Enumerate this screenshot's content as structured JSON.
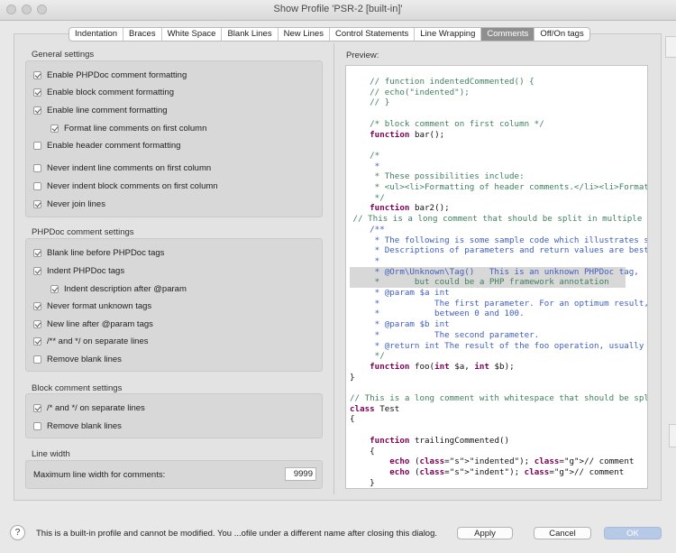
{
  "window": {
    "title": "Show Profile 'PSR-2 [built-in]'"
  },
  "tabs": [
    {
      "label": "Indentation",
      "active": false
    },
    {
      "label": "Braces",
      "active": false
    },
    {
      "label": "White Space",
      "active": false
    },
    {
      "label": "Blank Lines",
      "active": false
    },
    {
      "label": "New Lines",
      "active": false
    },
    {
      "label": "Control Statements",
      "active": false
    },
    {
      "label": "Line Wrapping",
      "active": false
    },
    {
      "label": "Comments",
      "active": true
    },
    {
      "label": "Off/On tags",
      "active": false
    }
  ],
  "general": {
    "title": "General settings",
    "options": [
      {
        "label": "Enable PHPDoc comment formatting",
        "checked": true
      },
      {
        "label": "Enable block comment formatting",
        "checked": true
      },
      {
        "label": "Enable line comment formatting",
        "checked": true
      },
      {
        "label": "Format line comments on first column",
        "checked": true
      },
      {
        "label": "Enable header comment formatting",
        "checked": false
      },
      {
        "label": "Never indent line comments on first column",
        "checked": false
      },
      {
        "label": "Never indent block comments on first column",
        "checked": false
      },
      {
        "label": "Never join lines",
        "checked": true
      }
    ]
  },
  "phpdoc": {
    "title": "PHPDoc comment settings",
    "options": [
      {
        "label": "Blank line before PHPDoc tags",
        "checked": true
      },
      {
        "label": "Indent PHPDoc tags",
        "checked": true
      },
      {
        "label": "Indent description after @param",
        "checked": true
      },
      {
        "label": "Never format unknown tags",
        "checked": true
      },
      {
        "label": "New line after @param tags",
        "checked": true
      },
      {
        "label": "/** and */ on separate lines",
        "checked": true
      },
      {
        "label": "Remove blank lines",
        "checked": false
      }
    ]
  },
  "block": {
    "title": "Block comment settings",
    "options": [
      {
        "label": "/* and */ on separate lines",
        "checked": true
      },
      {
        "label": "Remove blank lines",
        "checked": false
      }
    ]
  },
  "linewidth": {
    "title": "Line width",
    "label": "Maximum line width for comments:",
    "value": "9999"
  },
  "preview": {
    "label": "Preview:",
    "lines": [
      "    // function indentedCommented() {",
      "    // echo(\"indented\");",
      "    // }",
      "",
      "    /* block comment on first column */",
      "    function bar();",
      "",
      "    /*",
      "     *",
      "     * These possibilities include:",
      "     * <ul><li>Formatting of header comments.</li><li>Formatting",
      "     */",
      "    function bar2();",
      " // This is a long comment that should be split in multiple line",
      "    /**",
      "     * The following is some sample code which illustrates source",
      "     * Descriptions of parameters and return values are best appe",
      "     *",
      "     * @Orm\\Unknown\\Tag()   This is an unknown PHPDoc tag,",
      "     *       but could be a PHP framework annotation",
      "     * @param $a int",
      "     *           The first parameter. For an optimum result, thi",
      "     *           between 0 and 100.",
      "     * @param $b int",
      "     *           The second parameter.",
      "     * @return int The result of the foo operation, usually withi",
      "     */",
      "    function foo(int $a, int $b);",
      "}",
      "",
      "// This is a long comment with whitespace that should be split in",
      "class Test",
      "{",
      "",
      "    function trailingCommented()",
      "    {",
      "        echo (\"indented\"); // comment",
      "        echo (\"indent\"); // comment",
      "    }"
    ]
  },
  "footer": {
    "help": "?",
    "message": "This is a built-in profile and cannot be modified. You ...ofile under a different name after closing this dialog.",
    "apply": "Apply",
    "cancel": "Cancel",
    "ok": "OK"
  }
}
